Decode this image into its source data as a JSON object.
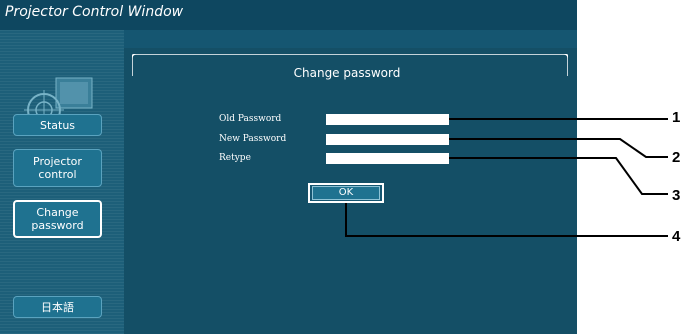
{
  "window": {
    "title": "Projector Control Window"
  },
  "sidebar": {
    "items": [
      {
        "label": "Status",
        "active": false
      },
      {
        "label": "Projector\ncontrol",
        "active": false
      },
      {
        "label": "Change\npassword",
        "active": true
      },
      {
        "label": "日本語",
        "active": false
      }
    ]
  },
  "main": {
    "title": "Change password",
    "fields": [
      {
        "label": "Old Password",
        "value": ""
      },
      {
        "label": "New Password",
        "value": ""
      },
      {
        "label": "Retype",
        "value": ""
      }
    ],
    "ok_label": "OK"
  },
  "callouts": [
    "1",
    "2",
    "3",
    "4"
  ],
  "colors": {
    "window_bg": "#155671",
    "titlebar_bg": "#0e4760",
    "button_bg": "#1f7290",
    "accent_white": "#ffffff"
  }
}
